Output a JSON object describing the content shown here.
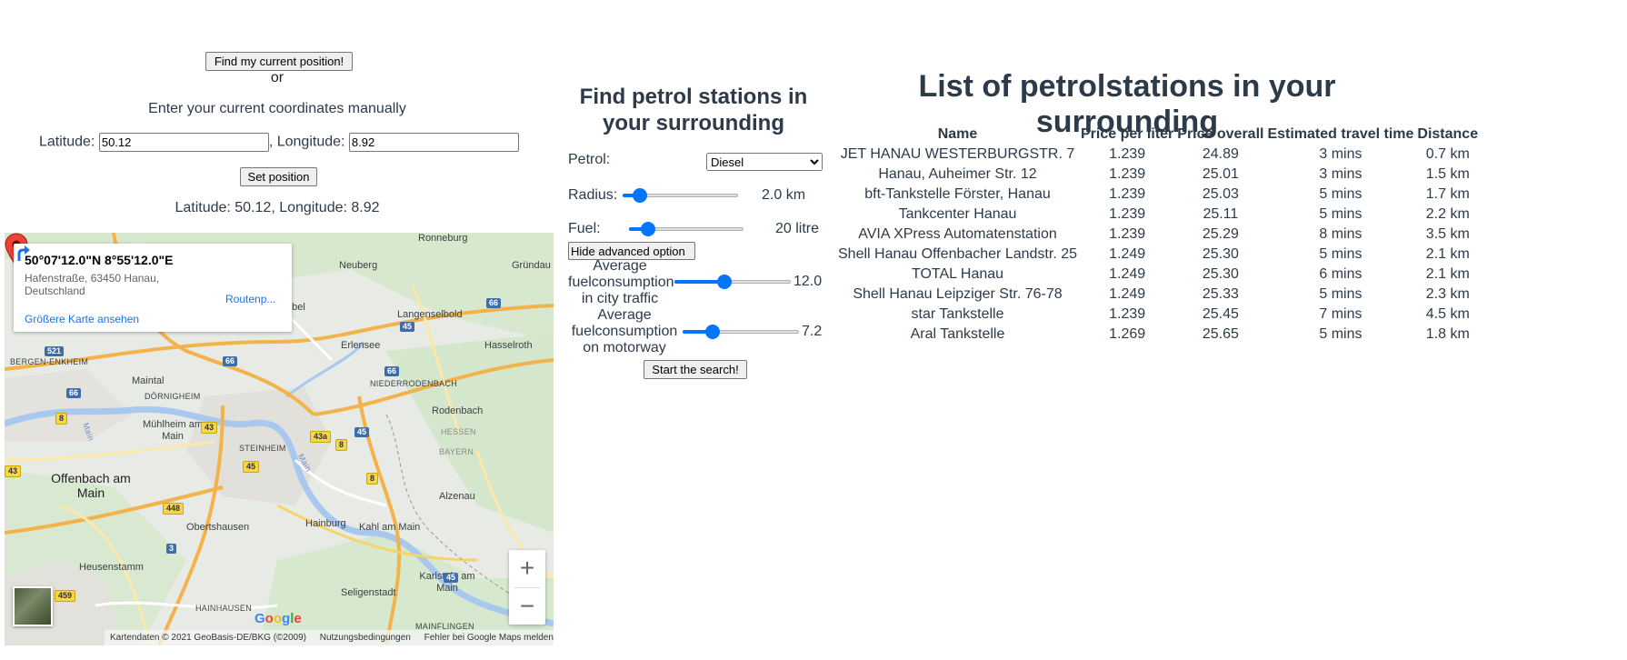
{
  "position": {
    "find_button": "Find my current position!",
    "or_text": "or",
    "manual_text": "Enter your current coordinates manually",
    "lat_label": "Latitude:",
    "lon_label": ", Longitude:",
    "lat_value": "50.12",
    "lon_value": "8.92",
    "set_button": "Set position",
    "display": "Latitude: 50.12, Longitude: 8.92"
  },
  "map": {
    "coord_title": "50°07'12.0\"N 8°55'12.0\"E",
    "address": "Hafenstraße, 63450 Hanau, Deutschland",
    "bigger_map": "Größere Karte ansehen",
    "route": "Routenp...",
    "zoom_in": "+",
    "zoom_out": "−",
    "footer": {
      "data": "Kartendaten © 2021 GeoBasis-DE/BKG (©2009)",
      "terms": "Nutzungsbedingungen",
      "report": "Fehler bei Google Maps melden"
    },
    "google": [
      "G",
      "o",
      "o",
      "g",
      "l",
      "e"
    ],
    "labels": {
      "ronneburg": "Ronneburg",
      "neuberg": "Neuberg",
      "grundau": "Gründau",
      "erlensee": "Erlensee",
      "langenselbold": "Langenselbold",
      "hasselroth": "Hasselroth",
      "bergen": "BERGEN-ENKHEIM",
      "maintal": "Maintal",
      "dornigheim": "DÖRNIGHEIM",
      "niederrodenbach": "NIEDERRODENBACH",
      "rodenbach": "Rodenbach",
      "muehlheim": "Mühlheim am Main",
      "steinheim": "STEINHEIM",
      "hessen": "HESSEN",
      "bayern": "BAYERN",
      "offenbach": "Offenbach am Main",
      "alzenau": "Alzenau",
      "obertshausen": "Obertshausen",
      "hainburg": "Hainburg",
      "kahl": "Kahl am Main",
      "heusenstamm": "Heusenstamm",
      "hainhausen": "HAINHAUSEN",
      "seligenstadt": "Seligenstadt",
      "karlstein": "Karlstein am Main",
      "mainflingen": "MAINFLINGEN",
      "main_river": "Main",
      "bobel": "öbel"
    },
    "shields": [
      "521",
      "66",
      "66",
      "45",
      "66",
      "8",
      "43",
      "43a",
      "45",
      "8",
      "45",
      "8",
      "448",
      "3",
      "45",
      "459",
      "43",
      "66"
    ]
  },
  "search": {
    "title": "Find petrol stations in your surrounding",
    "petrol_label": "Petrol:",
    "petrol_options": [
      "Diesel"
    ],
    "petrol_selected": "Diesel",
    "radius_label": "Radius:",
    "radius_value": "2.0 km",
    "radius_fraction": 0.1,
    "fuel_label": "Fuel:",
    "fuel_value": "20 litre",
    "fuel_fraction": 0.12,
    "hide_button": "Hide advanced option",
    "city_label": "Average fuelconsumption in city traffic",
    "city_value": "12.0",
    "city_fraction": 0.42,
    "motorway_label": "Average fuelconsumption on motorway",
    "motorway_value": "7.2",
    "motorway_fraction": 0.22,
    "start_button": "Start the search!"
  },
  "results": {
    "title": "List of petrolstations in your surrounding",
    "columns": [
      "Name",
      "Price per liter",
      "Price overall",
      "Estimated travel time",
      "Distance"
    ],
    "rows": [
      [
        "JET HANAU WESTERBURGSTR. 7",
        "1.239",
        "24.89",
        "3 mins",
        "0.7 km"
      ],
      [
        "Hanau, Auheimer Str. 12",
        "1.239",
        "25.01",
        "3 mins",
        "1.5 km"
      ],
      [
        "bft-Tankstelle Förster, Hanau",
        "1.239",
        "25.03",
        "5 mins",
        "1.7 km"
      ],
      [
        "Tankcenter Hanau",
        "1.239",
        "25.11",
        "5 mins",
        "2.2 km"
      ],
      [
        "AVIA XPress Automatenstation",
        "1.239",
        "25.29",
        "8 mins",
        "3.5 km"
      ],
      [
        "Shell Hanau Offenbacher Landstr. 25",
        "1.249",
        "25.30",
        "5 mins",
        "2.1 km"
      ],
      [
        "TOTAL Hanau",
        "1.249",
        "25.30",
        "6 mins",
        "2.1 km"
      ],
      [
        "Shell Hanau Leipziger Str. 76-78",
        "1.249",
        "25.33",
        "5 mins",
        "2.3 km"
      ],
      [
        "star Tankstelle",
        "1.239",
        "25.45",
        "7 mins",
        "4.5 km"
      ],
      [
        "Aral Tankstelle",
        "1.269",
        "25.65",
        "5 mins",
        "1.8 km"
      ]
    ]
  }
}
